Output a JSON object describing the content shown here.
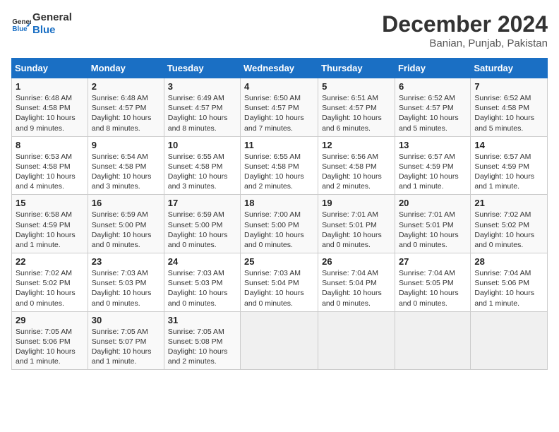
{
  "header": {
    "logo_general": "General",
    "logo_blue": "Blue",
    "month_title": "December 2024",
    "subtitle": "Banian, Punjab, Pakistan"
  },
  "calendar": {
    "days_of_week": [
      "Sunday",
      "Monday",
      "Tuesday",
      "Wednesday",
      "Thursday",
      "Friday",
      "Saturday"
    ],
    "weeks": [
      [
        {
          "day": "1",
          "info": "Sunrise: 6:48 AM\nSunset: 4:58 PM\nDaylight: 10 hours and 9 minutes."
        },
        {
          "day": "2",
          "info": "Sunrise: 6:48 AM\nSunset: 4:57 PM\nDaylight: 10 hours and 8 minutes."
        },
        {
          "day": "3",
          "info": "Sunrise: 6:49 AM\nSunset: 4:57 PM\nDaylight: 10 hours and 8 minutes."
        },
        {
          "day": "4",
          "info": "Sunrise: 6:50 AM\nSunset: 4:57 PM\nDaylight: 10 hours and 7 minutes."
        },
        {
          "day": "5",
          "info": "Sunrise: 6:51 AM\nSunset: 4:57 PM\nDaylight: 10 hours and 6 minutes."
        },
        {
          "day": "6",
          "info": "Sunrise: 6:52 AM\nSunset: 4:57 PM\nDaylight: 10 hours and 5 minutes."
        },
        {
          "day": "7",
          "info": "Sunrise: 6:52 AM\nSunset: 4:58 PM\nDaylight: 10 hours and 5 minutes."
        }
      ],
      [
        {
          "day": "8",
          "info": "Sunrise: 6:53 AM\nSunset: 4:58 PM\nDaylight: 10 hours and 4 minutes."
        },
        {
          "day": "9",
          "info": "Sunrise: 6:54 AM\nSunset: 4:58 PM\nDaylight: 10 hours and 3 minutes."
        },
        {
          "day": "10",
          "info": "Sunrise: 6:55 AM\nSunset: 4:58 PM\nDaylight: 10 hours and 3 minutes."
        },
        {
          "day": "11",
          "info": "Sunrise: 6:55 AM\nSunset: 4:58 PM\nDaylight: 10 hours and 2 minutes."
        },
        {
          "day": "12",
          "info": "Sunrise: 6:56 AM\nSunset: 4:58 PM\nDaylight: 10 hours and 2 minutes."
        },
        {
          "day": "13",
          "info": "Sunrise: 6:57 AM\nSunset: 4:59 PM\nDaylight: 10 hours and 1 minute."
        },
        {
          "day": "14",
          "info": "Sunrise: 6:57 AM\nSunset: 4:59 PM\nDaylight: 10 hours and 1 minute."
        }
      ],
      [
        {
          "day": "15",
          "info": "Sunrise: 6:58 AM\nSunset: 4:59 PM\nDaylight: 10 hours and 1 minute."
        },
        {
          "day": "16",
          "info": "Sunrise: 6:59 AM\nSunset: 5:00 PM\nDaylight: 10 hours and 0 minutes."
        },
        {
          "day": "17",
          "info": "Sunrise: 6:59 AM\nSunset: 5:00 PM\nDaylight: 10 hours and 0 minutes."
        },
        {
          "day": "18",
          "info": "Sunrise: 7:00 AM\nSunset: 5:00 PM\nDaylight: 10 hours and 0 minutes."
        },
        {
          "day": "19",
          "info": "Sunrise: 7:01 AM\nSunset: 5:01 PM\nDaylight: 10 hours and 0 minutes."
        },
        {
          "day": "20",
          "info": "Sunrise: 7:01 AM\nSunset: 5:01 PM\nDaylight: 10 hours and 0 minutes."
        },
        {
          "day": "21",
          "info": "Sunrise: 7:02 AM\nSunset: 5:02 PM\nDaylight: 10 hours and 0 minutes."
        }
      ],
      [
        {
          "day": "22",
          "info": "Sunrise: 7:02 AM\nSunset: 5:02 PM\nDaylight: 10 hours and 0 minutes."
        },
        {
          "day": "23",
          "info": "Sunrise: 7:03 AM\nSunset: 5:03 PM\nDaylight: 10 hours and 0 minutes."
        },
        {
          "day": "24",
          "info": "Sunrise: 7:03 AM\nSunset: 5:03 PM\nDaylight: 10 hours and 0 minutes."
        },
        {
          "day": "25",
          "info": "Sunrise: 7:03 AM\nSunset: 5:04 PM\nDaylight: 10 hours and 0 minutes."
        },
        {
          "day": "26",
          "info": "Sunrise: 7:04 AM\nSunset: 5:04 PM\nDaylight: 10 hours and 0 minutes."
        },
        {
          "day": "27",
          "info": "Sunrise: 7:04 AM\nSunset: 5:05 PM\nDaylight: 10 hours and 0 minutes."
        },
        {
          "day": "28",
          "info": "Sunrise: 7:04 AM\nSunset: 5:06 PM\nDaylight: 10 hours and 1 minute."
        }
      ],
      [
        {
          "day": "29",
          "info": "Sunrise: 7:05 AM\nSunset: 5:06 PM\nDaylight: 10 hours and 1 minute."
        },
        {
          "day": "30",
          "info": "Sunrise: 7:05 AM\nSunset: 5:07 PM\nDaylight: 10 hours and 1 minute."
        },
        {
          "day": "31",
          "info": "Sunrise: 7:05 AM\nSunset: 5:08 PM\nDaylight: 10 hours and 2 minutes."
        },
        {
          "day": "",
          "info": ""
        },
        {
          "day": "",
          "info": ""
        },
        {
          "day": "",
          "info": ""
        },
        {
          "day": "",
          "info": ""
        }
      ]
    ]
  }
}
